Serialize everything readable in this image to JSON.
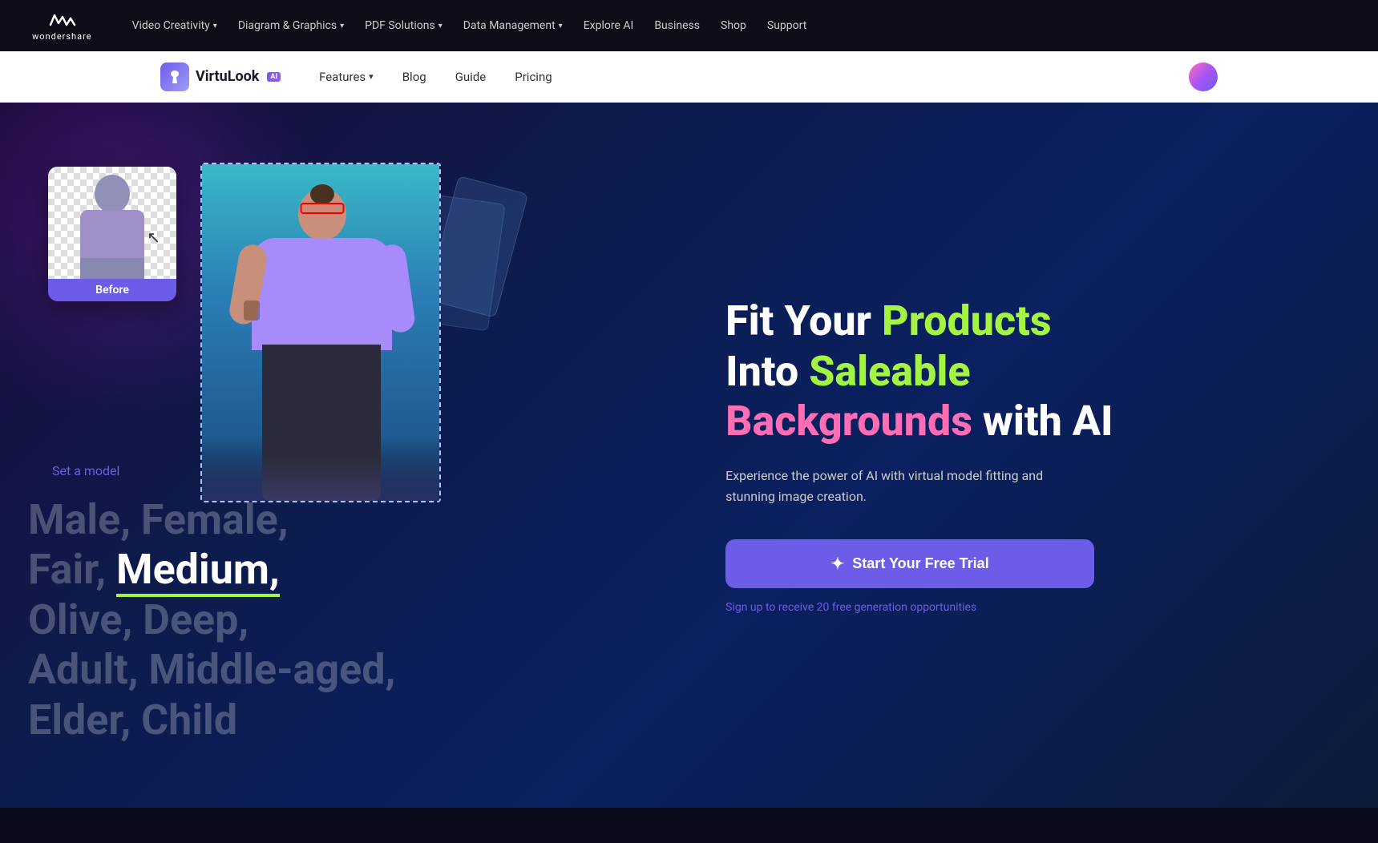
{
  "topNav": {
    "logo": {
      "name": "wondershare",
      "label": "wondershare"
    },
    "items": [
      {
        "label": "Video Creativity",
        "hasDropdown": true
      },
      {
        "label": "Diagram & Graphics",
        "hasDropdown": true
      },
      {
        "label": "PDF Solutions",
        "hasDropdown": true
      },
      {
        "label": "Data Management",
        "hasDropdown": true
      },
      {
        "label": "Explore AI",
        "hasDropdown": false
      },
      {
        "label": "Business",
        "hasDropdown": false
      },
      {
        "label": "Shop",
        "hasDropdown": false
      },
      {
        "label": "Support",
        "hasDropdown": false
      }
    ]
  },
  "subNav": {
    "brand": {
      "name": "VirtuLook",
      "aiBadge": "AI"
    },
    "items": [
      {
        "label": "Features",
        "hasDropdown": true
      },
      {
        "label": "Blog",
        "hasDropdown": false
      },
      {
        "label": "Guide",
        "hasDropdown": false
      },
      {
        "label": "Pricing",
        "hasDropdown": false
      }
    ]
  },
  "hero": {
    "beforeLabel": "Before",
    "setModelLink": "Set a model",
    "bodyTypes": {
      "line1": "Male, Female,",
      "line2Prefix": "Fair, ",
      "line2Highlighted": "Medium,",
      "line3": "Olive, Deep,",
      "line4": "Adult, Middle-aged,",
      "line5": "Elder, Child"
    },
    "title": {
      "line1White": "Fit Your ",
      "line1Green": "Products",
      "line2White": "Into ",
      "line2Green": "Saleable",
      "line3Pink": "Backgrounds",
      "line3White": " with AI"
    },
    "description": "Experience the power of AI with virtual model fitting and stunning image creation.",
    "ctaButton": "Start Your Free Trial",
    "signupText": "Sign up to receive 20 free generation opportunities"
  }
}
